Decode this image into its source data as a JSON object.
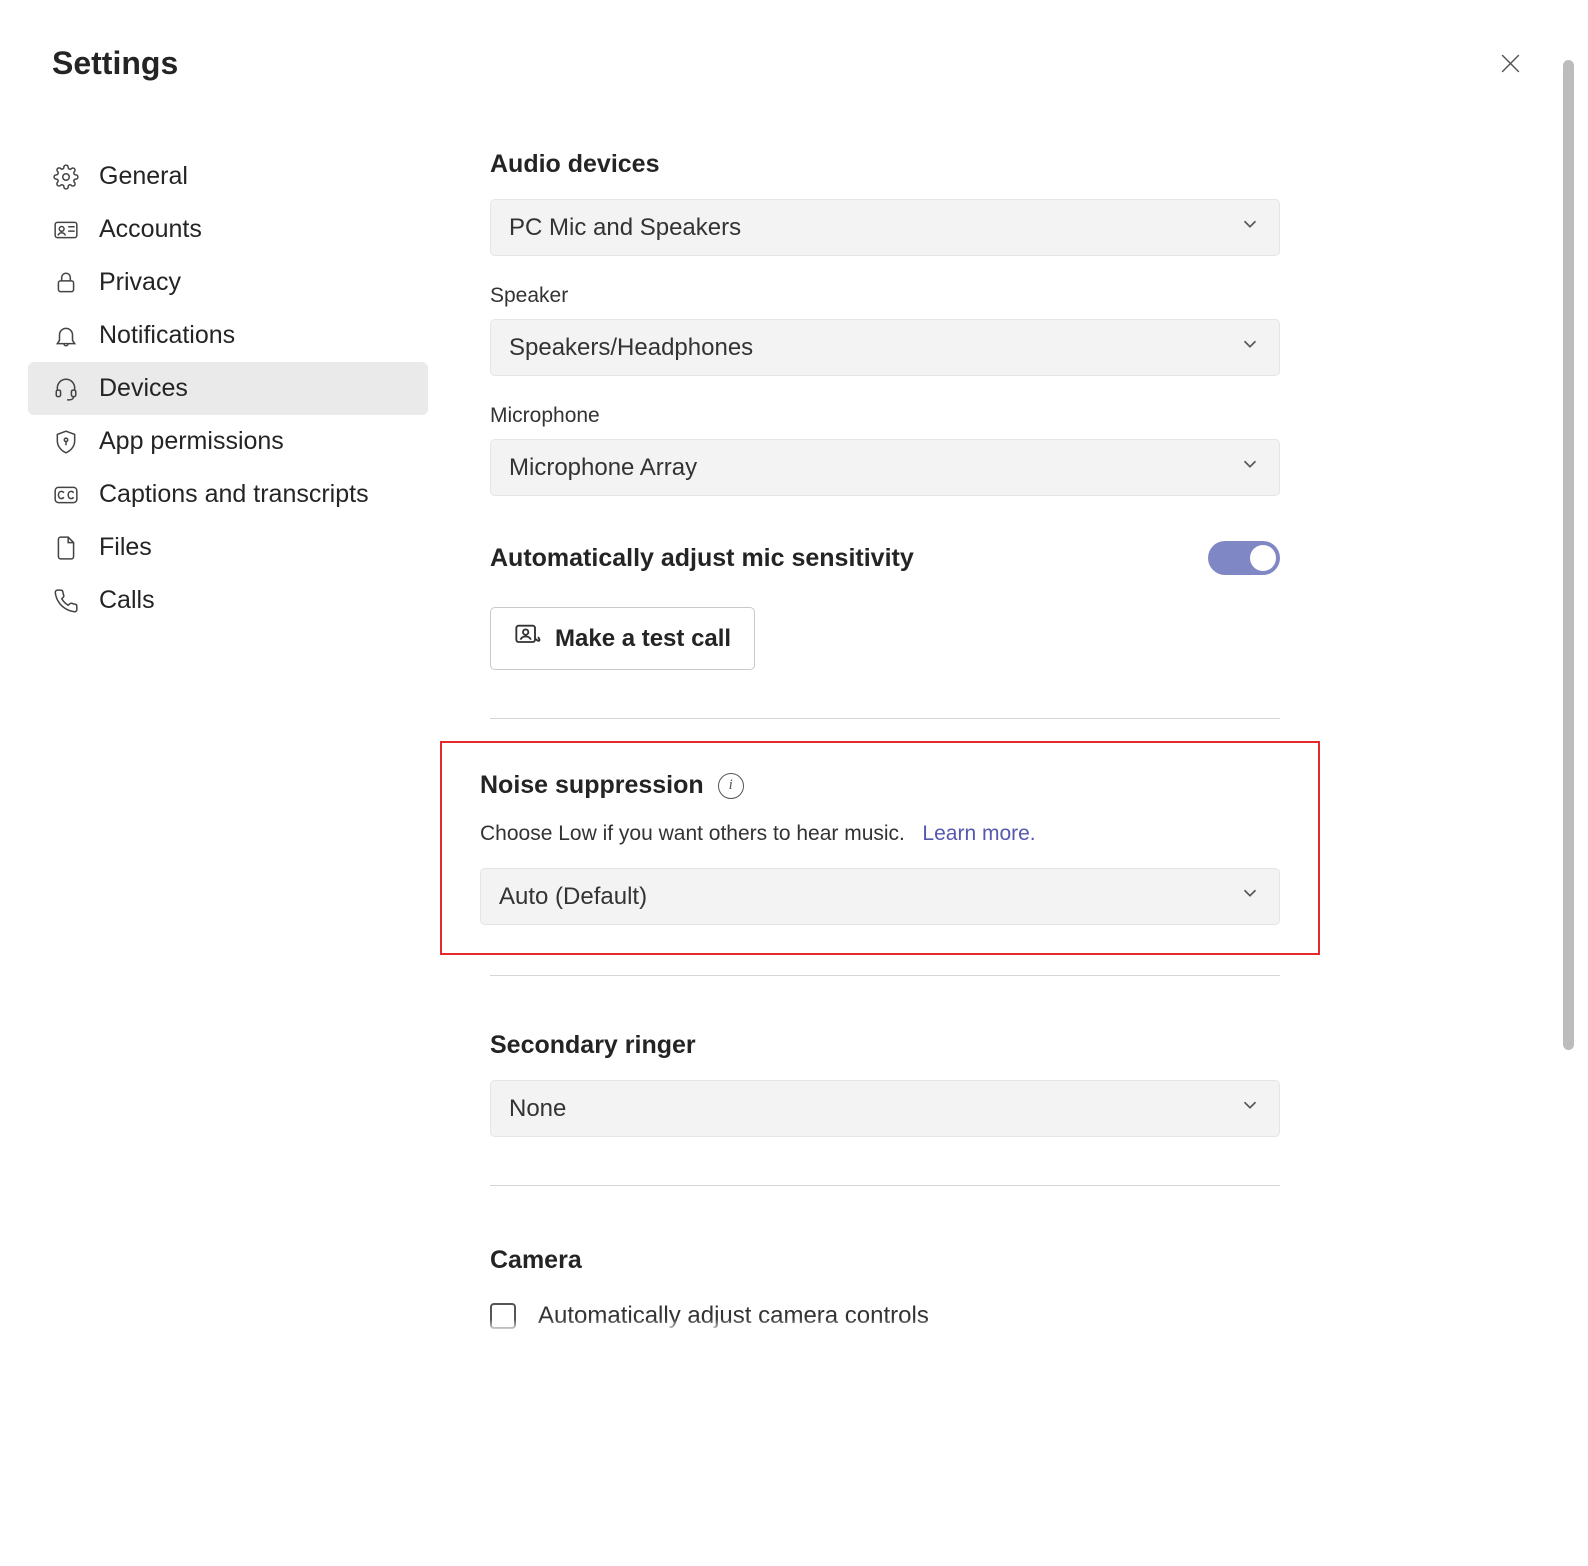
{
  "page_title": "Settings",
  "sidebar": {
    "items": [
      {
        "label": "General",
        "icon": "gear-icon",
        "active": false
      },
      {
        "label": "Accounts",
        "icon": "id-card-icon",
        "active": false
      },
      {
        "label": "Privacy",
        "icon": "lock-icon",
        "active": false
      },
      {
        "label": "Notifications",
        "icon": "bell-icon",
        "active": false
      },
      {
        "label": "Devices",
        "icon": "headset-icon",
        "active": true
      },
      {
        "label": "App permissions",
        "icon": "shield-key-icon",
        "active": false
      },
      {
        "label": "Captions and transcripts",
        "icon": "cc-icon",
        "active": false
      },
      {
        "label": "Files",
        "icon": "file-icon",
        "active": false
      },
      {
        "label": "Calls",
        "icon": "phone-icon",
        "active": false
      }
    ]
  },
  "main": {
    "audio_devices": {
      "label": "Audio devices",
      "value": "PC Mic and Speakers"
    },
    "speaker": {
      "label": "Speaker",
      "value": "Speakers/Headphones"
    },
    "microphone": {
      "label": "Microphone",
      "value": "Microphone Array"
    },
    "auto_mic": {
      "label": "Automatically adjust mic sensitivity",
      "enabled": true
    },
    "test_call_label": "Make a test call",
    "noise_suppression": {
      "title": "Noise suppression",
      "desc": "Choose Low if you want others to hear music.",
      "link": "Learn more.",
      "value": "Auto (Default)"
    },
    "secondary_ringer": {
      "label": "Secondary ringer",
      "value": "None"
    },
    "camera": {
      "label": "Camera",
      "auto_controls_label": "Automatically adjust camera controls"
    }
  }
}
